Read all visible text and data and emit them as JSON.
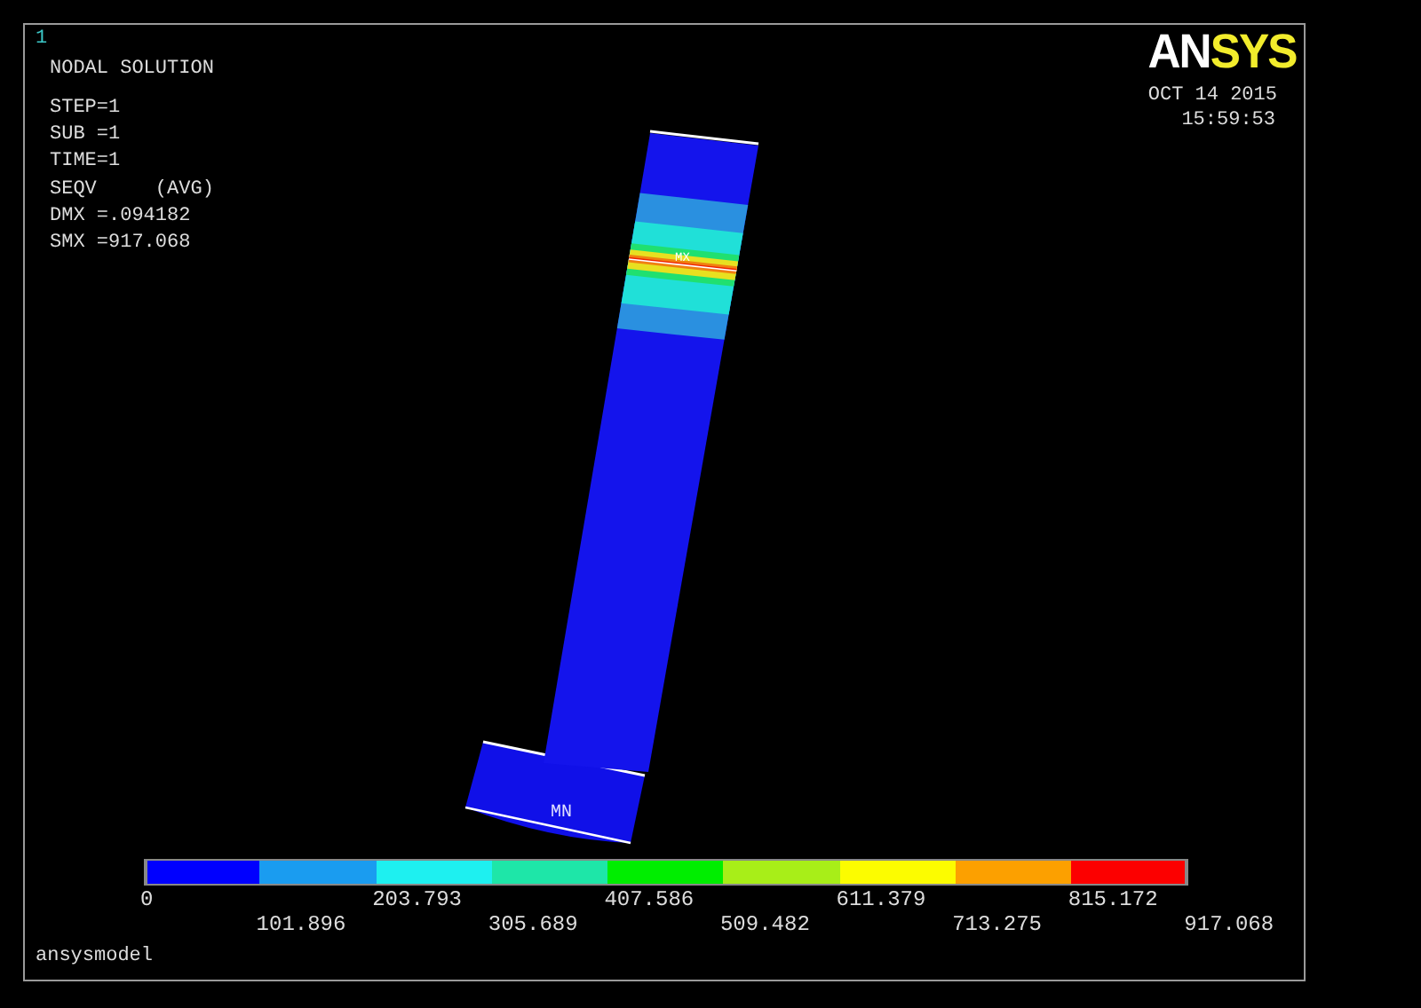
{
  "window": {
    "number": "1",
    "title": "NODAL SOLUTION"
  },
  "stats": [
    "STEP=1",
    "SUB =1",
    "TIME=1",
    "SEQV     (AVG)",
    "DMX =.094182",
    "SMX =917.068"
  ],
  "logo": {
    "parts": [
      {
        "text": "AN",
        "color": "#ffffff"
      },
      {
        "text": "SYS",
        "color": "#f2ec2c"
      }
    ]
  },
  "date": "OCT 14 2015",
  "time": "15:59:53",
  "model": {
    "max_label": "MX",
    "min_label": "MN"
  },
  "legend": {
    "bands": [
      {
        "color": "#0000ff"
      },
      {
        "color": "#1a9cf0"
      },
      {
        "color": "#1ef0f0"
      },
      {
        "color": "#1ee6a8"
      },
      {
        "color": "#00ee00"
      },
      {
        "color": "#a8ee18"
      },
      {
        "color": "#fcfc00"
      },
      {
        "color": "#fca000"
      },
      {
        "color": "#fc0000"
      }
    ],
    "ticks": [
      "0",
      "101.896",
      "203.793",
      "305.689",
      "407.586",
      "509.482",
      "611.379",
      "713.275",
      "815.172",
      "917.068"
    ]
  },
  "footer": "ansysmodel"
}
